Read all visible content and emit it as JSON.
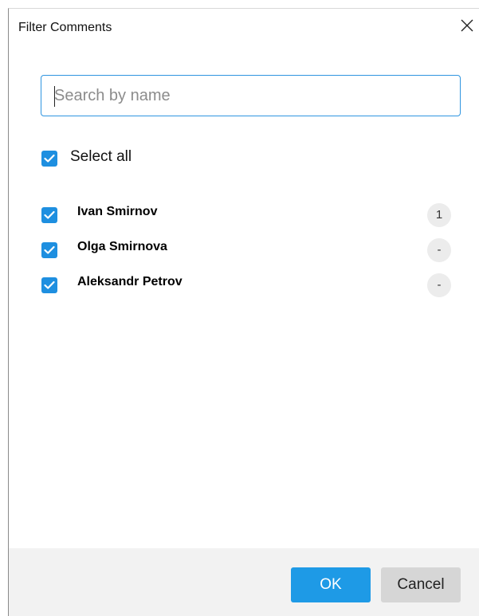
{
  "dialog": {
    "title": "Filter Comments"
  },
  "search": {
    "placeholder": "Search by name",
    "value": ""
  },
  "select_all": {
    "label": "Select all",
    "checked": true
  },
  "people": [
    {
      "name": "Ivan Smirnov",
      "count": "1",
      "checked": true
    },
    {
      "name": "Olga Smirnova",
      "count": "-",
      "checked": true
    },
    {
      "name": "Aleksandr Petrov",
      "count": "-",
      "checked": true
    }
  ],
  "buttons": {
    "ok_label": "OK",
    "cancel_label": "Cancel"
  },
  "colors": {
    "accent": "#1e8fe0",
    "ok_button": "#1e9ae6",
    "footer_bg": "#f2f2f2"
  },
  "icons": {
    "close": "close-icon",
    "check": "check-icon"
  }
}
